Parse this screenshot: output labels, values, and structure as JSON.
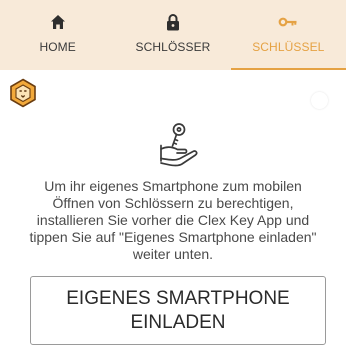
{
  "tabs": [
    {
      "label": "HOME",
      "icon": "home-icon",
      "active": false
    },
    {
      "label": "SCHLÖSSER",
      "icon": "lock-icon",
      "active": false
    },
    {
      "label": "SCHLÜSSEL",
      "icon": "key-icon",
      "active": true
    }
  ],
  "colors": {
    "tabbar_bg": "#f8ead9",
    "accent": "#e5a244",
    "text": "#4a4a4a"
  },
  "logo": {
    "icon": "lion-logo-icon"
  },
  "main": {
    "illustration_icon": "hand-with-key-icon",
    "info_text": "Um ihr eigenes Smartphone zum mobilen\nÖffnen von Schlössern zu berechtigen,\ninstallieren Sie vorher die Clex Key App und\ntippen Sie auf \"Eigenes Smartphone einladen\"\nweiter unten.",
    "invite_button_label": "EIGENES SMARTPHONE\nEINLADEN"
  }
}
